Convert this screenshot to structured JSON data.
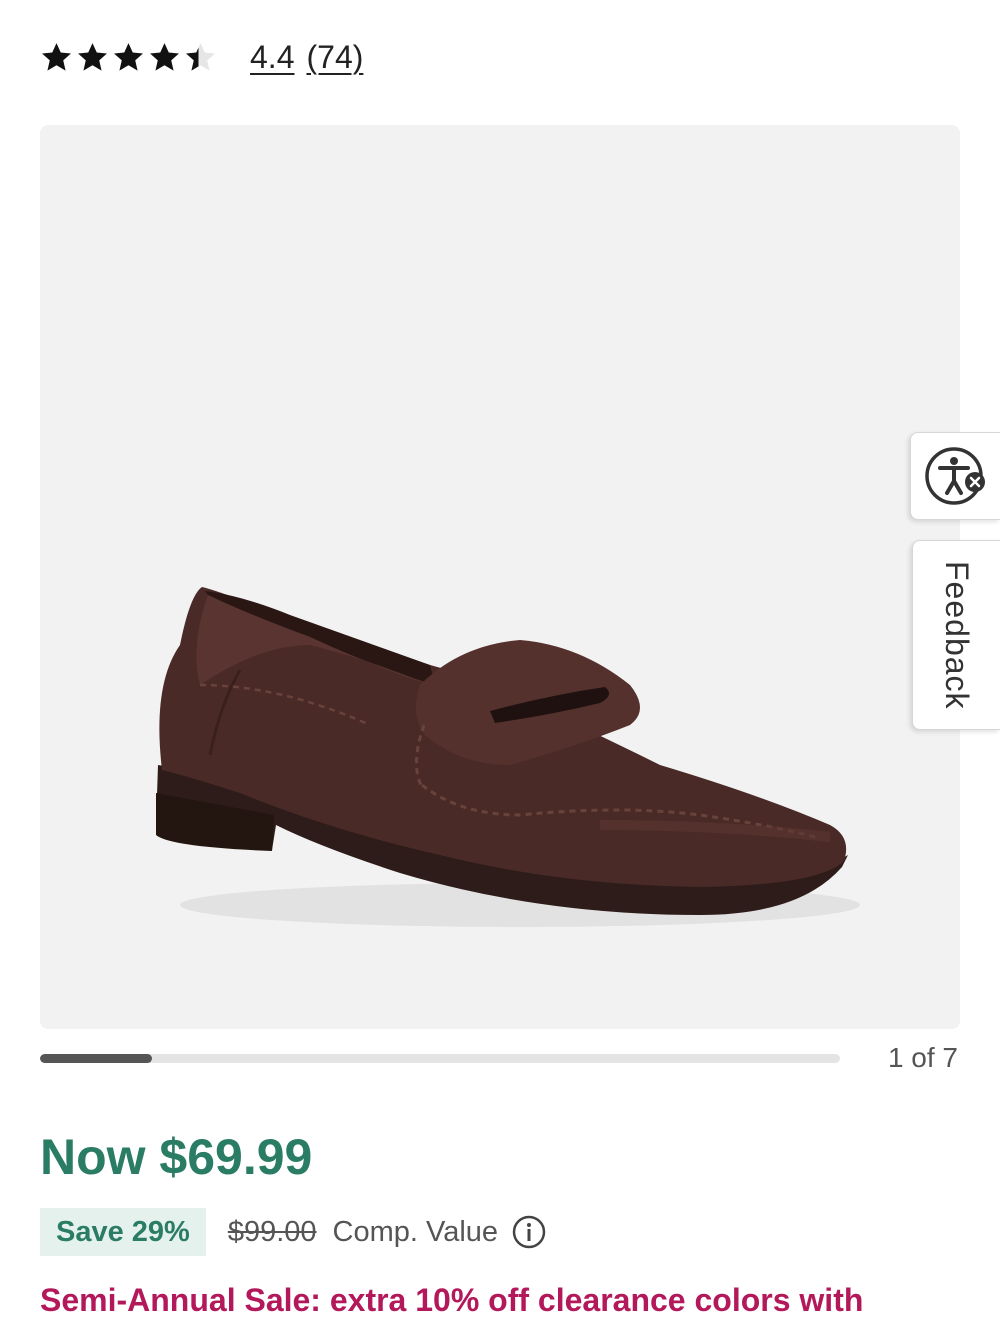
{
  "rating": {
    "stars": 4.4,
    "value": "4.4",
    "count": "(74)"
  },
  "gallery": {
    "image_alt": "Brown suede penny loafer",
    "counter": "1 of 7",
    "progress": 0.14
  },
  "side_widgets": {
    "accessibility_icon": "accessibility-icon",
    "feedback_label": "Feedback"
  },
  "price": {
    "now": "Now $69.99",
    "save": "Save 29%",
    "original": "$99.00",
    "comp_value": "Comp. Value"
  },
  "promo": {
    "text": "Semi-Annual Sale: extra 10% off clearance colors with"
  },
  "colors": {
    "price_green": "#2a7d64",
    "promo_red": "#b3195a",
    "shoe_brown": "#4a2a27"
  }
}
